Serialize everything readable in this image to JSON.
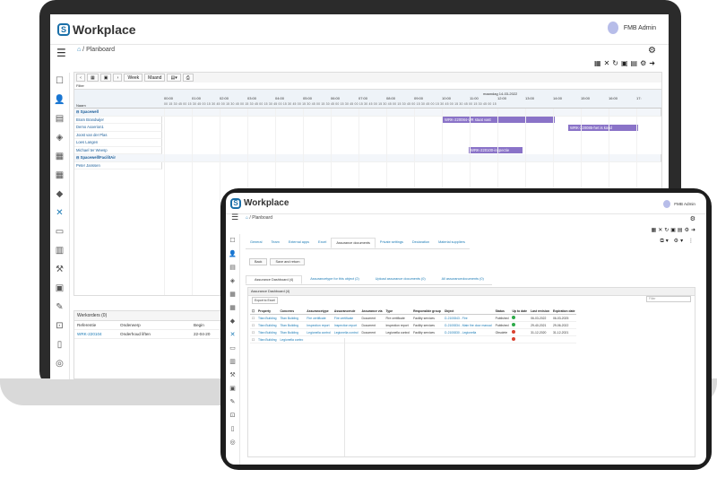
{
  "colors": {
    "accent": "#1a7ab5",
    "bar": "#8a73c8",
    "green": "#2eaa4a",
    "red": "#d9412f"
  },
  "brand": {
    "name": "Workplace",
    "mark": "S"
  },
  "user": {
    "name": "FMB Admin"
  },
  "breadcrumb": {
    "laptop": "Planboard",
    "tablet": "Planboard"
  },
  "planner": {
    "buttons": [
      "Week",
      "Maand"
    ],
    "filter_label": "Filter",
    "date_label": "maandag 14-03-2022",
    "name_header": "Naam",
    "hours": [
      "00:00",
      "01:00",
      "02:00",
      "03:00",
      "04:00",
      "05:00",
      "06:00",
      "07:00",
      "08:00",
      "09:00",
      "10:00",
      "11:00",
      "12:00",
      "13:00",
      "14:00",
      "15:00",
      "16:00",
      "17:"
    ],
    "minutes": "00 15 30 45 00 15 30 45 00 15 30 45 00 15 30 45 00 15 30 45 00 15 30 45 00 15 30 45 00 15 30 45 00 15 30 45 00 15 30 45 00 15 30 45 00 15 30 45 00 15 30 45 00 15 30 45 00 15 30 45 00 15 30 45 00 15 30 45 00 15",
    "rows": [
      {
        "label": "Spacewell",
        "group": true
      },
      {
        "label": "Bram Brandwijer",
        "group": false
      },
      {
        "label": "Demo Axxerion1",
        "group": false
      },
      {
        "label": "Joost van der Plas",
        "group": false
      },
      {
        "label": "Loes Langen",
        "group": false
      },
      {
        "label": "Michael ter Weesp",
        "group": false
      },
      {
        "label": "Spacewell/FacilitAir",
        "group": true
      },
      {
        "label": "Peter Janssen",
        "group": false
      }
    ],
    "bars": [
      {
        "label": "WRK-220084-UR staat vast",
        "row": 1
      },
      {
        "label": "WRK-220085-het is koud",
        "row": 2
      },
      {
        "label": "WRK-220100-inspectie",
        "row": 5
      }
    ]
  },
  "workorders": {
    "title": "Werkorders (0)",
    "headers": [
      "Referentie",
      "Onderwerp",
      "Begin"
    ],
    "rows": [
      [
        "WRK-220104",
        "Onderhoud liften",
        "22-04-20"
      ]
    ]
  },
  "assurance": {
    "tabs": [
      "General",
      "Team",
      "External apps",
      "Excel",
      "Assurance documents",
      "Private settings",
      "Declaration",
      "Material suppliers"
    ],
    "active_tab": "Assurance documents",
    "buttons": [
      "Back",
      "Save and return"
    ],
    "subtabs": [
      "Assurance Dashboard (4)",
      "Assurancetype for this object (2)",
      "Upload assurance documents (0)",
      "All assurancedocuments (0)"
    ],
    "panel_title": "Assurance Dashboard (4)",
    "export_label": "Export to Excel",
    "filter_placeholder": "Filter",
    "headers": [
      "Property",
      "Concerns",
      "Assurancetype",
      "Assurancerule",
      "Assurance via",
      "Type",
      "Responsible group",
      "Object",
      "Status",
      "Up to date",
      "Last revision",
      "Expiration date"
    ],
    "rows": [
      [
        "Titan Building",
        "Titan Building",
        "Fire certificate",
        "Fire certificate",
        "Document",
        "Fire certificate",
        "Facility services",
        "O-2100843 - Fire",
        "Published",
        "green",
        "06-03-2022",
        "06-03-2025"
      ],
      [
        "Titan Building",
        "Titan Building",
        "Inspection report",
        "Inspection report",
        "Document",
        "Inspection report",
        "Facility services",
        "O-2100834 - Main fire door manual",
        "Published",
        "green",
        "29-40-2021",
        "29-06-2022"
      ],
      [
        "Titan Building",
        "Titan Building",
        "Legionella control",
        "Legionella control",
        "Document",
        "Legionella control",
        "Facility services",
        "O-2100830 - Legionella",
        "Obsolete",
        "red",
        "31-12-2020",
        "31-12-2021"
      ],
      [
        "Titan Building",
        "Legionella contro",
        "",
        "",
        "",
        "",
        "",
        "",
        "",
        "red",
        "",
        ""
      ]
    ]
  }
}
